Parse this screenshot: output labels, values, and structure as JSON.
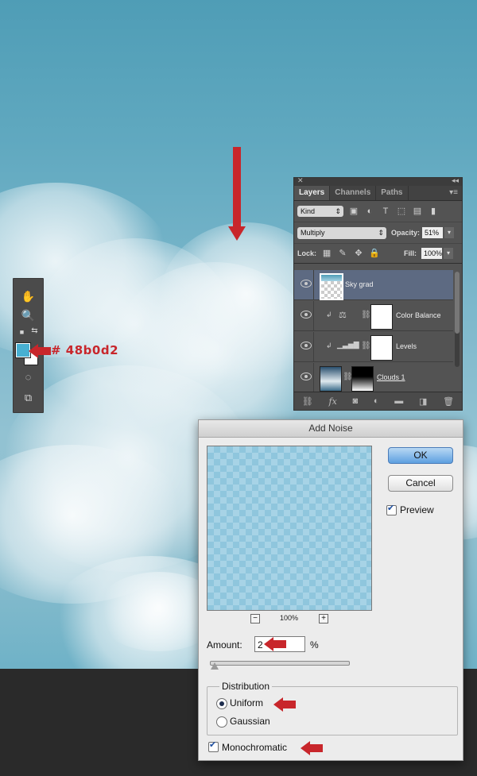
{
  "annotation": {
    "color_hex_label": "# 48b0d2",
    "accent": "#c8262b"
  },
  "tools_panel": {
    "foreground_color": "#48b0d2",
    "background_color": "#ffffff",
    "icons": [
      "hand-icon",
      "zoom-icon",
      "default-colors-icon",
      "swap-colors-icon",
      "quick-mask-icon",
      "screen-mode-icon"
    ]
  },
  "layers_panel": {
    "tabs": [
      "Layers",
      "Channels",
      "Paths"
    ],
    "kind_filter": "Kind",
    "blend_mode": "Multiply",
    "opacity_label": "Opacity:",
    "opacity_value": "51%",
    "lock_label": "Lock:",
    "fill_label": "Fill:",
    "fill_value": "100%",
    "layers": [
      {
        "name": "Sky grad",
        "selected": true
      },
      {
        "name": "Color Balance",
        "selected": false
      },
      {
        "name": "Levels",
        "selected": false
      },
      {
        "name": "Clouds 1",
        "selected": false
      }
    ]
  },
  "dialog": {
    "title": "Add Noise",
    "ok_label": "OK",
    "cancel_label": "Cancel",
    "preview_label": "Preview",
    "preview_checked": true,
    "zoom_level": "100%",
    "amount_label": "Amount:",
    "amount_value": "2",
    "amount_unit": "%",
    "distribution_label": "Distribution",
    "uniform_label": "Uniform",
    "gaussian_label": "Gaussian",
    "selected_distribution": "Uniform",
    "monochromatic_label": "Monochromatic",
    "monochromatic_checked": true
  }
}
